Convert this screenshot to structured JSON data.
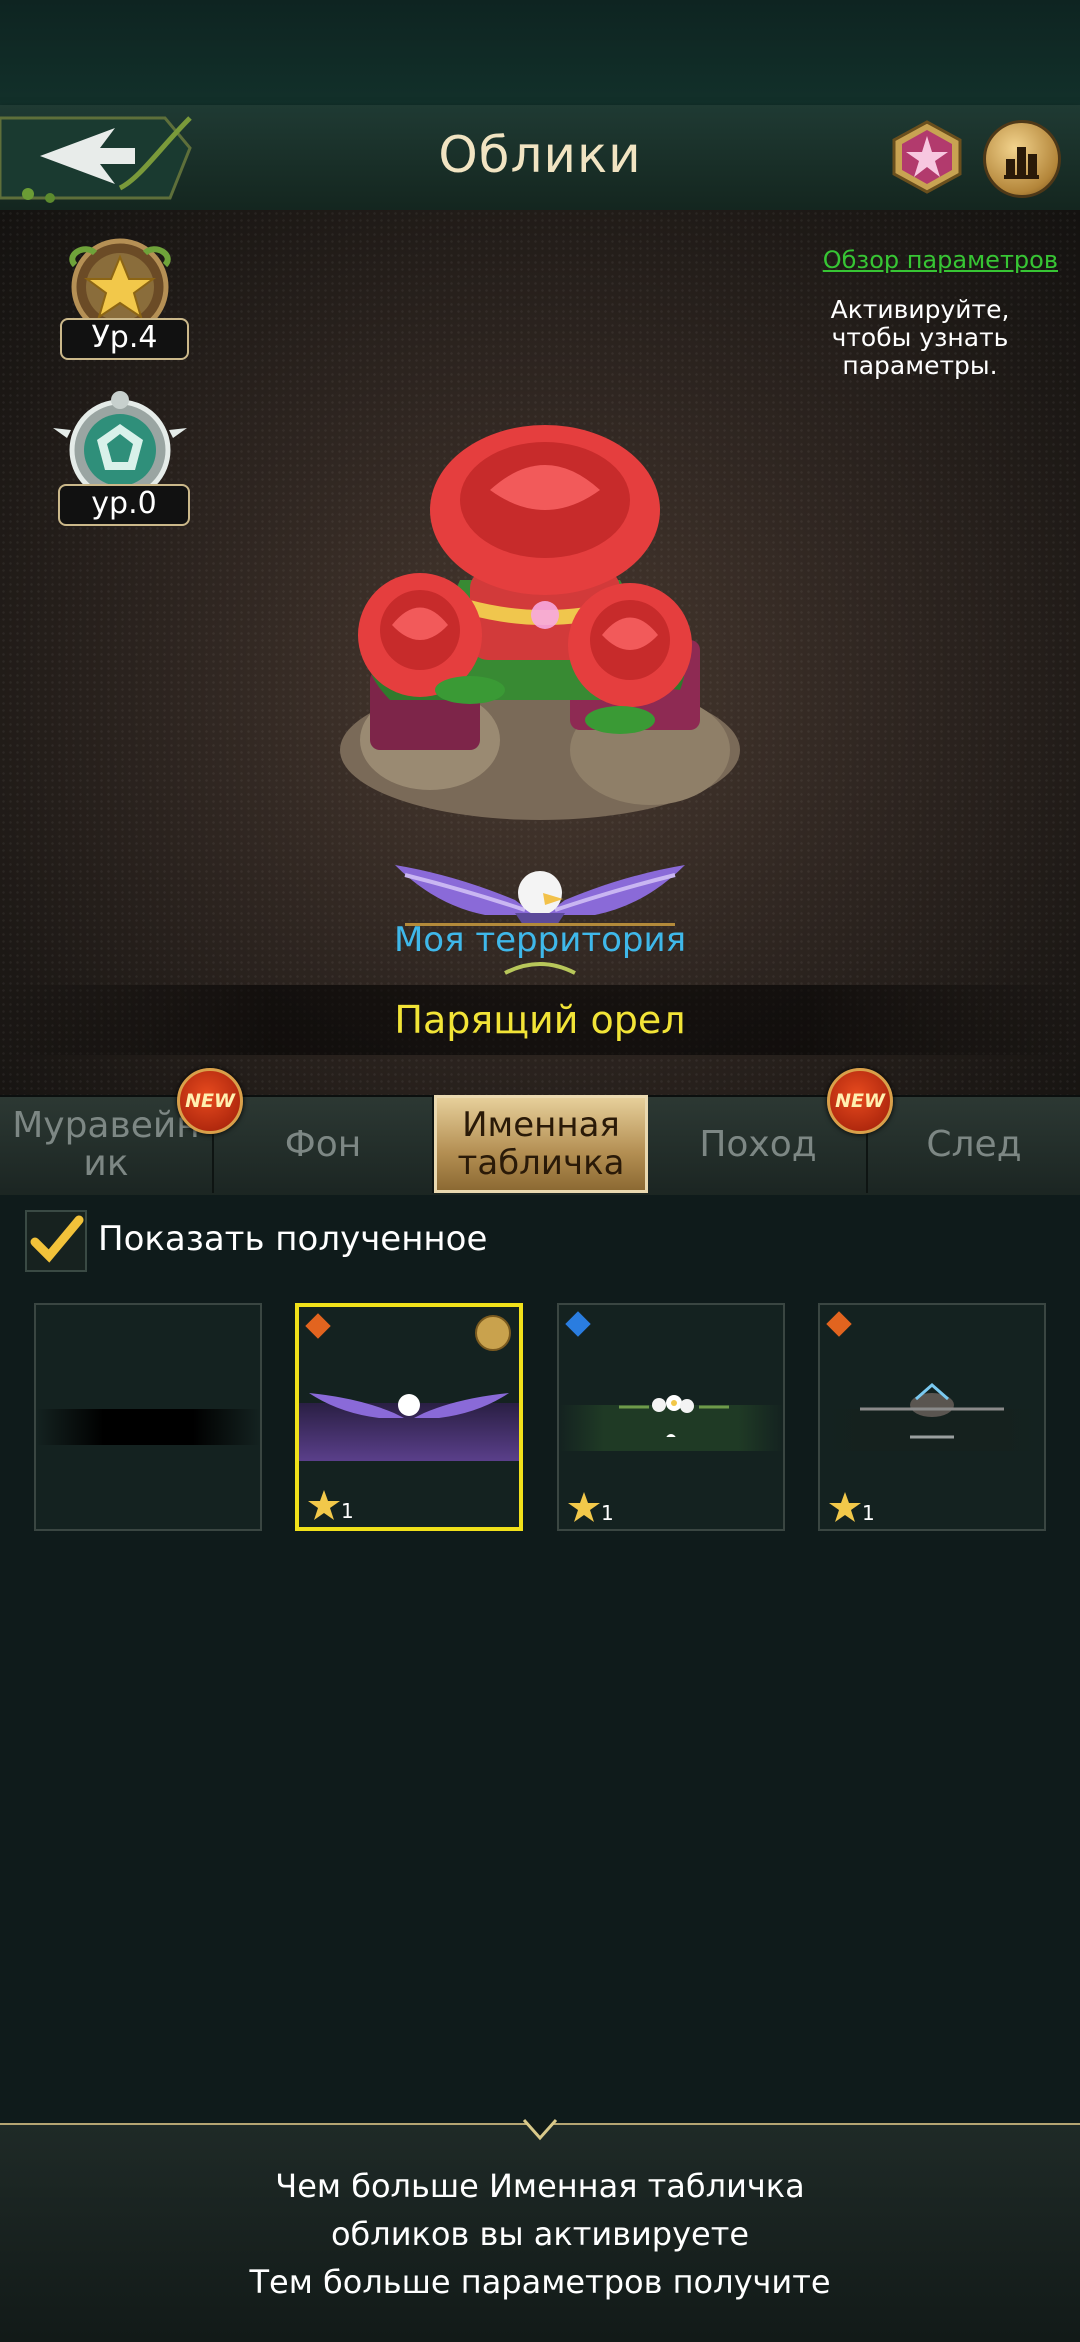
{
  "header": {
    "title": "Облики"
  },
  "profile": {
    "level1_label": "Ур.4",
    "level2_label": "ур.0"
  },
  "params": {
    "link": "Обзор параметров",
    "hint": "Активируйте, чтобы узнать параметры."
  },
  "preview": {
    "plate_text": "Моя территория",
    "skin_name": "Парящий орел"
  },
  "tabs": [
    {
      "label": "Муравейник",
      "new": "NEW"
    },
    {
      "label": "Фон"
    },
    {
      "label": "Именная табличка",
      "active": true
    },
    {
      "label": "Поход",
      "new": "NEW"
    },
    {
      "label": "След"
    }
  ],
  "filter": {
    "show_obtained": "Показать полученное"
  },
  "cards": [
    {
      "stars": ""
    },
    {
      "stars": "1",
      "gem": "orange"
    },
    {
      "stars": "1",
      "gem": "blue"
    },
    {
      "stars": "1",
      "gem": "orange"
    }
  ],
  "footer": {
    "line1": "Чем больше Именная табличка",
    "line2": "обликов вы активируете",
    "line3": "Тем больше параметров получите"
  },
  "colors": {
    "link": "#37c534",
    "plate_text": "#3fb8ea",
    "skin_name": "#f2e437",
    "selected_border": "#f1e11a"
  }
}
